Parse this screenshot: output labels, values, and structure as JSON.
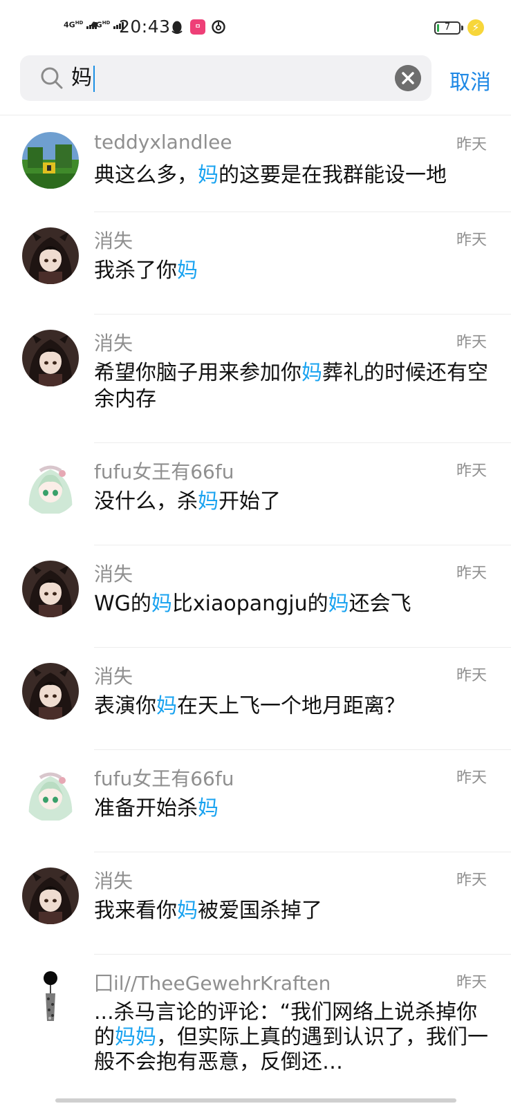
{
  "status_bar": {
    "signal1": "4G",
    "signal1_sup": "HD",
    "signal2": "4G",
    "signal2_sup": "HD",
    "time": "20:43",
    "battery_level": "7"
  },
  "search": {
    "query": "妈",
    "cancel_label": "取消"
  },
  "results": [
    {
      "name": "teddyxlandlee",
      "date": "昨天",
      "avatar": "landscape",
      "parts": [
        {
          "t": "典这么多，",
          "h": false
        },
        {
          "t": "妈",
          "h": true
        },
        {
          "t": "的这要是在我群能设一地",
          "h": false
        }
      ]
    },
    {
      "name": "消失",
      "date": "昨天",
      "avatar": "dark-girl",
      "parts": [
        {
          "t": "我杀了你",
          "h": false
        },
        {
          "t": "妈",
          "h": true
        }
      ]
    },
    {
      "name": "消失",
      "date": "昨天",
      "avatar": "dark-girl",
      "parts": [
        {
          "t": "希望你脑子用来参加你",
          "h": false
        },
        {
          "t": "妈",
          "h": true
        },
        {
          "t": "葬礼的时候还有空余内存",
          "h": false
        }
      ]
    },
    {
      "name": "fufu女王有66fu",
      "date": "昨天",
      "avatar": "green-girl",
      "parts": [
        {
          "t": "没什么，杀",
          "h": false
        },
        {
          "t": "妈",
          "h": true
        },
        {
          "t": "开始了",
          "h": false
        }
      ]
    },
    {
      "name": "消失",
      "date": "昨天",
      "avatar": "dark-girl",
      "parts": [
        {
          "t": "WG的",
          "h": false
        },
        {
          "t": "妈",
          "h": true
        },
        {
          "t": "比xiaopangju的",
          "h": false
        },
        {
          "t": "妈",
          "h": true
        },
        {
          "t": "还会飞",
          "h": false
        }
      ]
    },
    {
      "name": "消失",
      "date": "昨天",
      "avatar": "dark-girl",
      "parts": [
        {
          "t": "表演你",
          "h": false
        },
        {
          "t": "妈",
          "h": true
        },
        {
          "t": "在天上飞一个地月距离？",
          "h": false
        }
      ]
    },
    {
      "name": "fufu女王有66fu",
      "date": "昨天",
      "avatar": "green-girl",
      "parts": [
        {
          "t": "准备开始杀",
          "h": false
        },
        {
          "t": "妈",
          "h": true
        }
      ]
    },
    {
      "name": "消失",
      "date": "昨天",
      "avatar": "dark-girl",
      "parts": [
        {
          "t": "我来看你",
          "h": false
        },
        {
          "t": "妈",
          "h": true
        },
        {
          "t": "被爱国杀掉了",
          "h": false
        }
      ]
    },
    {
      "name": "囗il//TheeGewehrKraften",
      "date": "昨天",
      "avatar": "pendant",
      "parts": [
        {
          "t": "...杀马言论的评论：“我们网络上说杀掉你的",
          "h": false
        },
        {
          "t": "妈妈",
          "h": true
        },
        {
          "t": "，但实际上真的遇到认识了，我们一般不会抱有恶意，反倒还…",
          "h": false
        }
      ]
    }
  ]
}
